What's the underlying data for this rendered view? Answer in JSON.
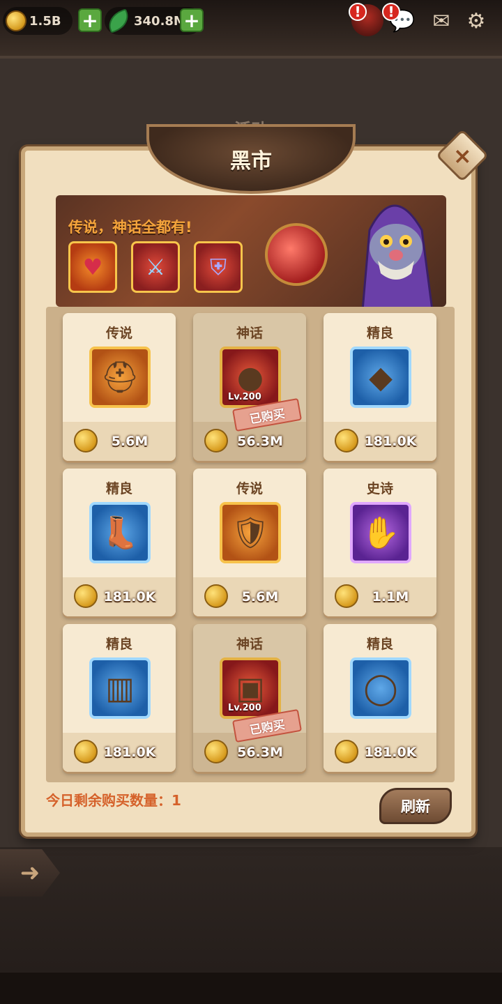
{
  "topbar": {
    "gold": "1.5B",
    "gems": "340.8M"
  },
  "panel": {
    "subtitle": "活动",
    "title": "黑市",
    "close_glyph": "×"
  },
  "banner": {
    "text": "传说，神话全都有!"
  },
  "items": [
    {
      "rarity": "传说",
      "price": "5.6M",
      "frame": "legend",
      "icon": "helmet-icon",
      "glyph": "⛑"
    },
    {
      "rarity": "神话",
      "price": "56.3M",
      "frame": "myth",
      "icon": "orb-icon",
      "glyph": "●",
      "level": "Lv.200",
      "sold": "已购买"
    },
    {
      "rarity": "精良",
      "price": "181.0K",
      "frame": "fine",
      "icon": "amulet-icon",
      "glyph": "◆"
    },
    {
      "rarity": "精良",
      "price": "181.0K",
      "frame": "fine",
      "icon": "boots-icon",
      "glyph": "👢"
    },
    {
      "rarity": "传说",
      "price": "5.6M",
      "frame": "legend",
      "icon": "armor-icon",
      "glyph": "🛡"
    },
    {
      "rarity": "史诗",
      "price": "1.1M",
      "frame": "epic",
      "icon": "gauntlet-icon",
      "glyph": "✋"
    },
    {
      "rarity": "精良",
      "price": "181.0K",
      "frame": "fine",
      "icon": "greaves-icon",
      "glyph": "▥"
    },
    {
      "rarity": "神话",
      "price": "56.3M",
      "frame": "myth",
      "icon": "chestplate-icon",
      "glyph": "▣",
      "level": "Lv.200",
      "sold": "已购买"
    },
    {
      "rarity": "精良",
      "price": "181.0K",
      "frame": "fine",
      "icon": "fang-ring-icon",
      "glyph": "◯"
    }
  ],
  "footer": {
    "remaining": "今日剩余购买数量：1",
    "refresh": "刷新"
  }
}
